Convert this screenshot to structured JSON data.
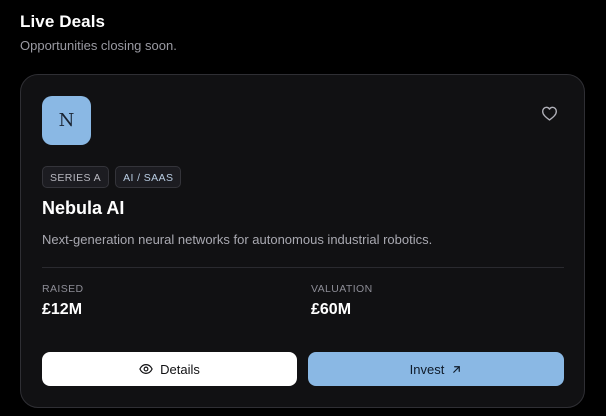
{
  "section": {
    "title": "Live Deals",
    "subtitle": "Opportunities closing soon."
  },
  "deal": {
    "logo_letter": "N",
    "favorite_icon": "heart-outline-icon",
    "tags": [
      "SERIES A",
      "AI / SAAS"
    ],
    "name": "Nebula AI",
    "description": "Next-generation neural networks for autonomous industrial robotics.",
    "stats": {
      "raised": {
        "label": "RAISED",
        "value": "£12M"
      },
      "valuation": {
        "label": "VALUATION",
        "value": "£60M"
      }
    },
    "actions": {
      "details_label": "Details",
      "details_icon": "eye-icon",
      "invest_label": "Invest",
      "invest_icon": "arrow-up-right-icon"
    }
  },
  "colors": {
    "background": "#000000",
    "card": "#111113",
    "accent": "#8ab8e4",
    "text_muted": "#a9a9b1"
  }
}
